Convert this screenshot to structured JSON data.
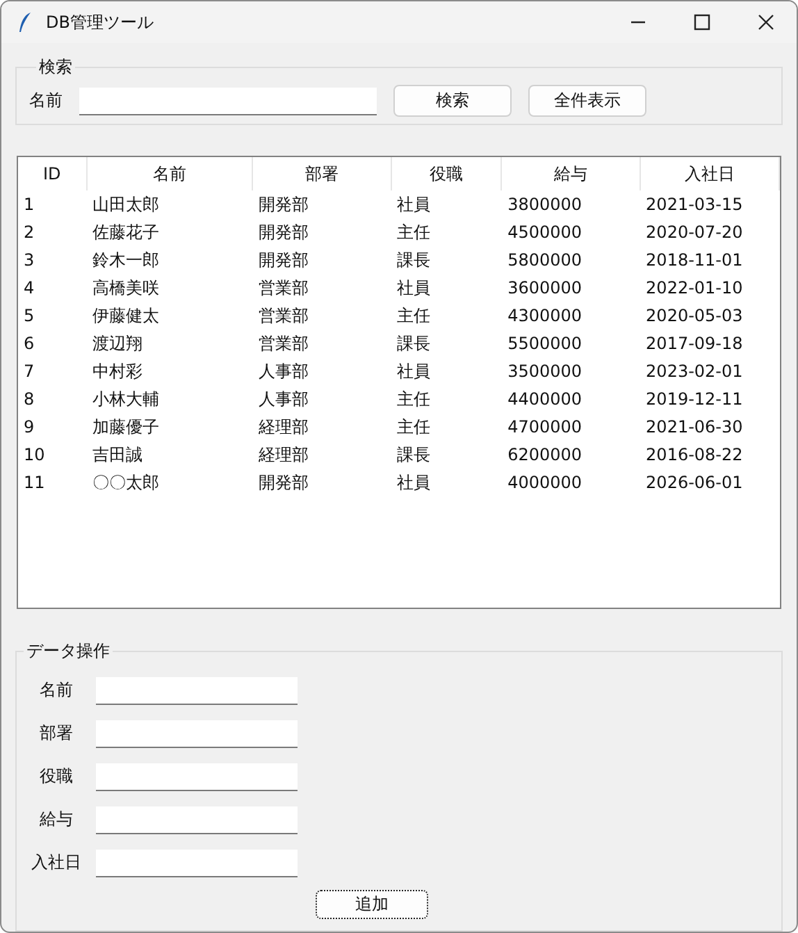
{
  "window": {
    "title": "DB管理ツール"
  },
  "search": {
    "legend": "検索",
    "label": "名前",
    "buttons": [
      "検索",
      "全件表示"
    ]
  },
  "table": {
    "columns": [
      "ID",
      "名前",
      "部署",
      "役職",
      "給与",
      "入社日"
    ],
    "rows": [
      [
        "1",
        "山田太郎",
        "開発部",
        "社員",
        "3800000",
        "2021-03-15"
      ],
      [
        "2",
        "佐藤花子",
        "開発部",
        "主任",
        "4500000",
        "2020-07-20"
      ],
      [
        "3",
        "鈴木一郎",
        "開発部",
        "課長",
        "5800000",
        "2018-11-01"
      ],
      [
        "4",
        "高橋美咲",
        "営業部",
        "社員",
        "3600000",
        "2022-01-10"
      ],
      [
        "5",
        "伊藤健太",
        "営業部",
        "主任",
        "4300000",
        "2020-05-03"
      ],
      [
        "6",
        "渡辺翔",
        "営業部",
        "課長",
        "5500000",
        "2017-09-18"
      ],
      [
        "7",
        "中村彩",
        "人事部",
        "社員",
        "3500000",
        "2023-02-01"
      ],
      [
        "8",
        "小林大輔",
        "人事部",
        "主任",
        "4400000",
        "2019-12-11"
      ],
      [
        "9",
        "加藤優子",
        "経理部",
        "主任",
        "4700000",
        "2021-06-30"
      ],
      [
        "10",
        "吉田誠",
        "経理部",
        "課長",
        "6200000",
        "2016-08-22"
      ],
      [
        "11",
        "〇〇太郎",
        "開発部",
        "社員",
        "4000000",
        "2026-06-01"
      ]
    ]
  },
  "data_ops": {
    "legend": "データ操作",
    "fields": [
      "名前",
      "部署",
      "役職",
      "給与",
      "入社日"
    ],
    "button": "追加"
  }
}
